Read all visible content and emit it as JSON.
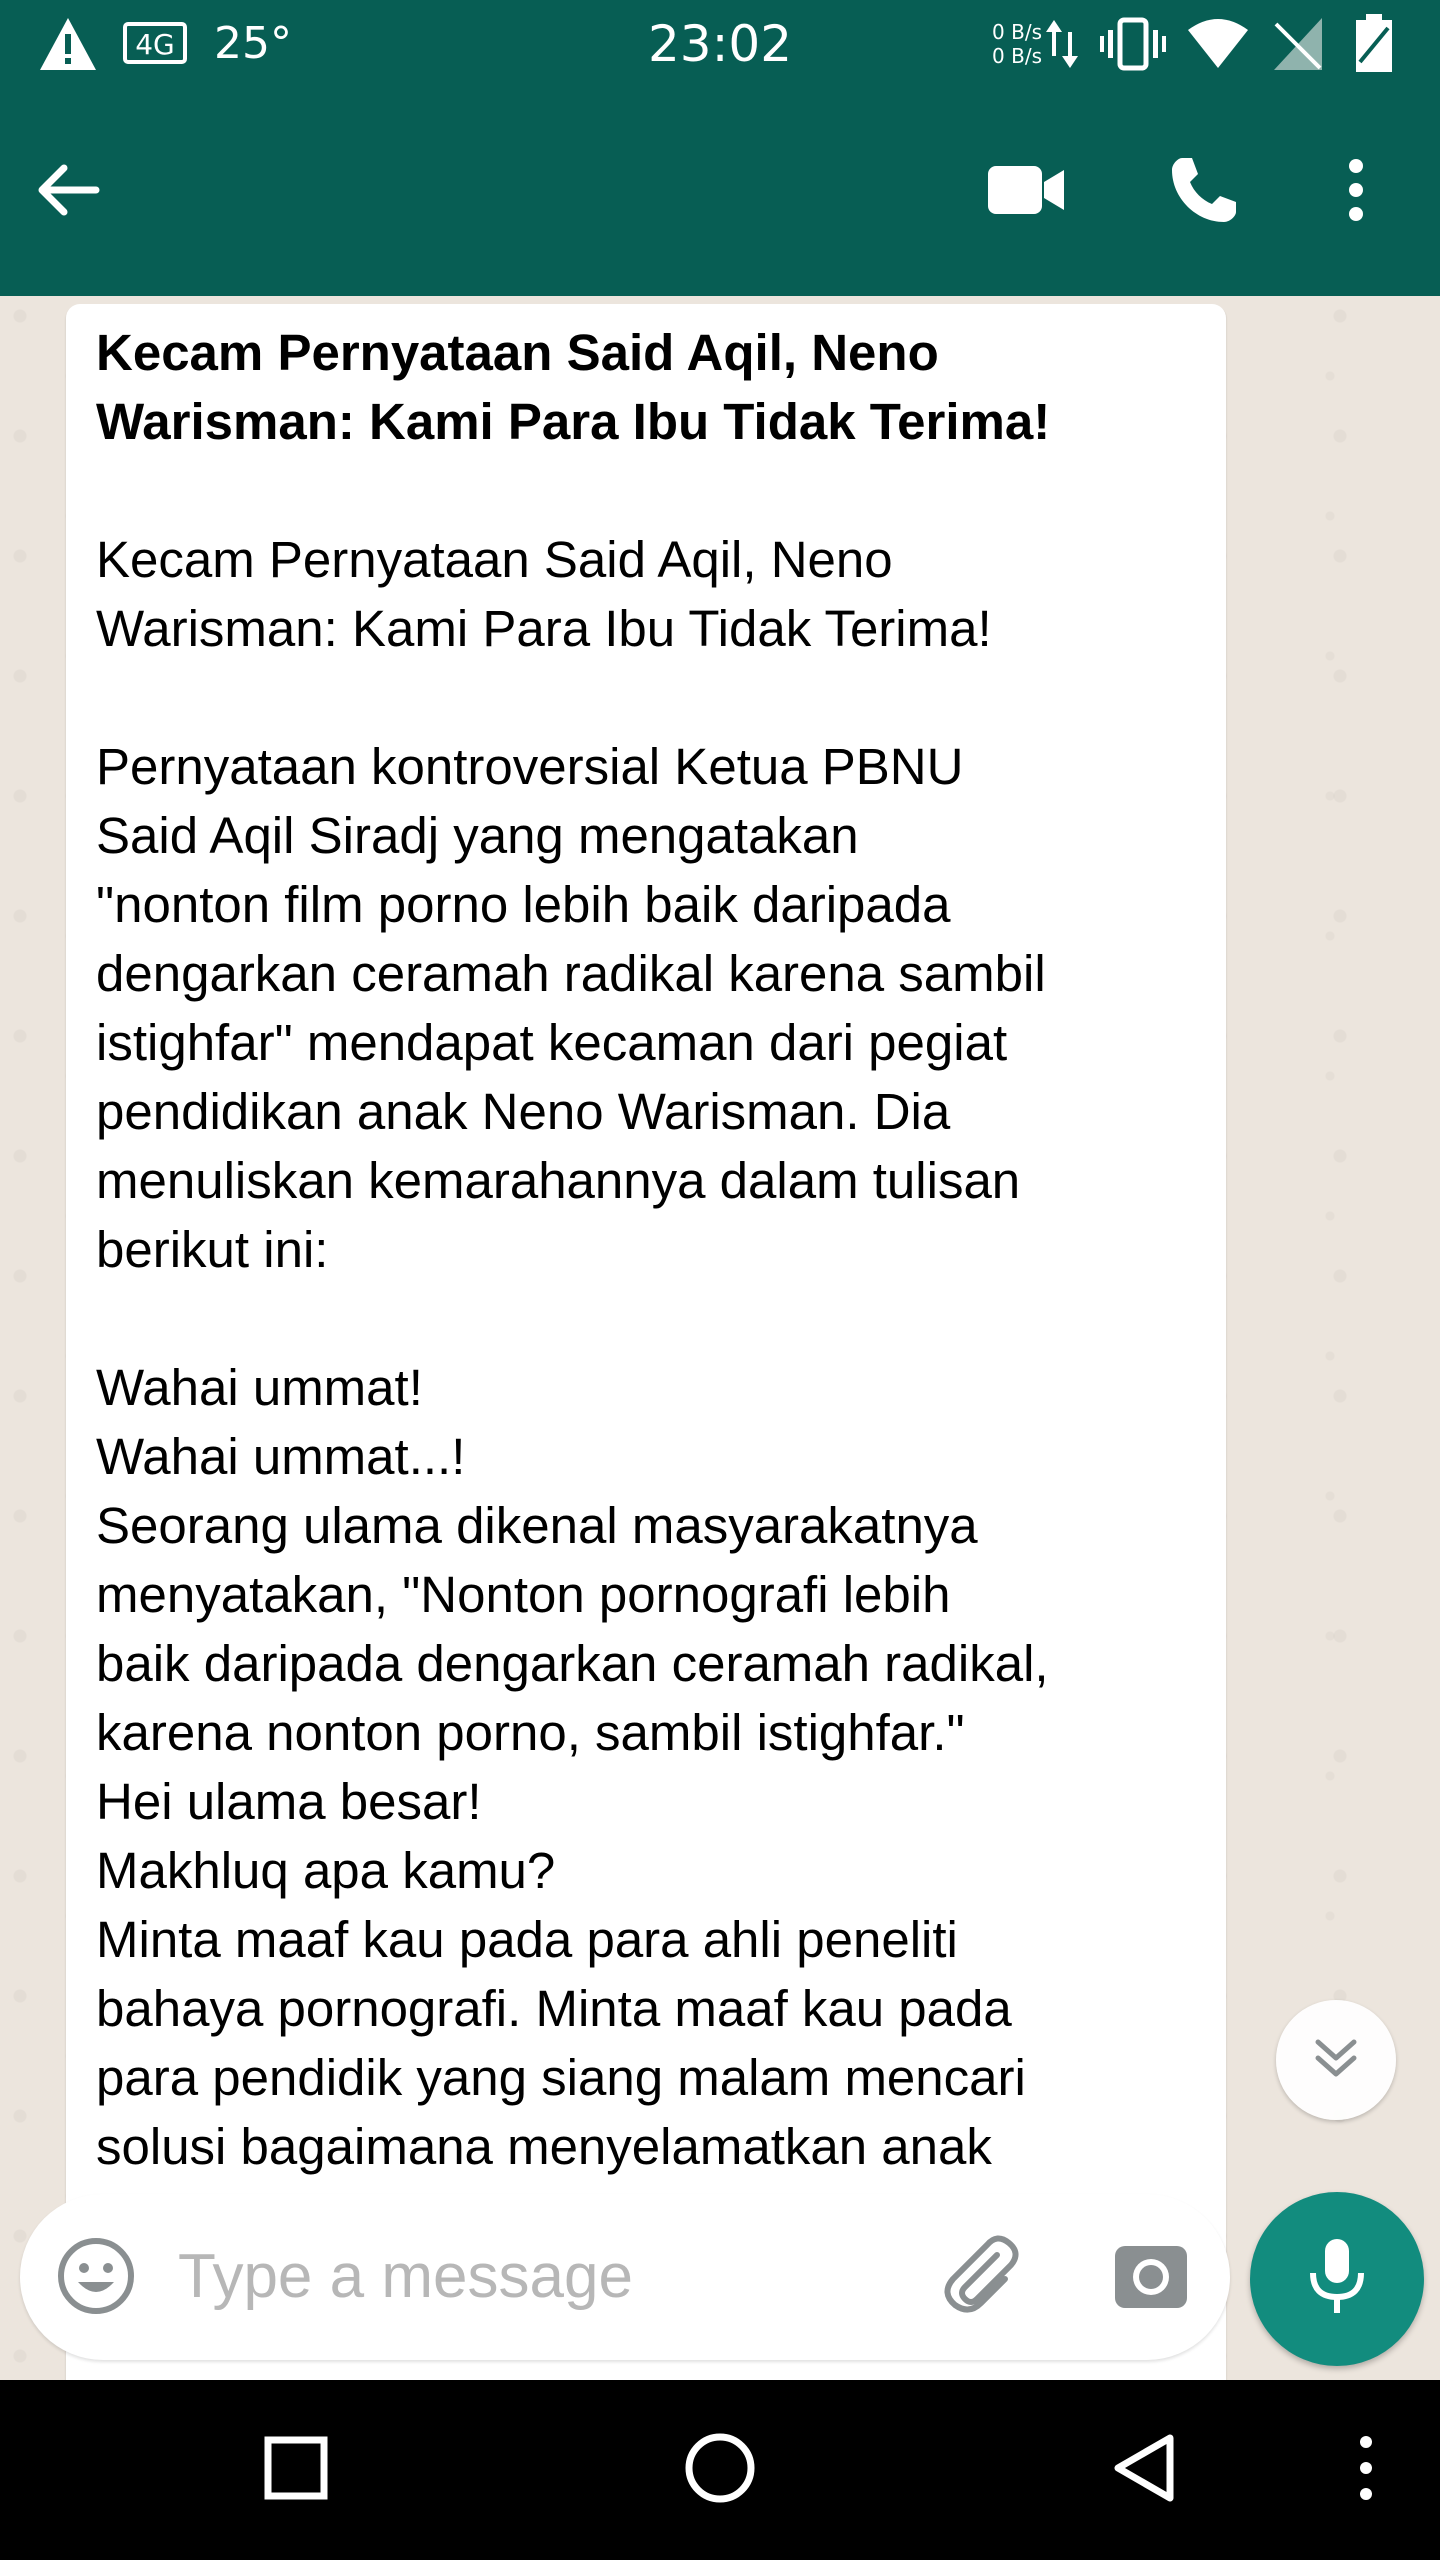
{
  "status_bar": {
    "network_type": "4G",
    "temperature": "25°",
    "time": "23:02",
    "net_up": "0 B/s",
    "net_down": "0 B/s"
  },
  "app_bar": {
    "back_icon": "arrow-back-icon",
    "video_call_icon": "video-camera-icon",
    "voice_call_icon": "phone-icon",
    "menu_icon": "more-vert-icon"
  },
  "message": {
    "title": "Kecam Pernyataan Said Aqil, Neno\nWarisman: Kami Para Ibu Tidak Terima!",
    "body": "\n\nKecam Pernyataan Said Aqil, Neno\nWarisman: Kami Para Ibu Tidak Terima!\n\nPernyataan kontroversial Ketua PBNU\nSaid Aqil Siradj yang mengatakan\n\"nonton film porno lebih baik daripada\ndengarkan ceramah radikal karena sambil\nistighfar\" mendapat kecaman dari pegiat\npendidikan anak Neno Warisman. Dia\nmenuliskan kemarahannya dalam tulisan\nberikut ini:\n\nWahai ummat!\nWahai ummat...!\nSeorang ulama dikenal masyarakatnya\nmenyatakan, \"Nonton pornografi lebih\nbaik daripada dengarkan ceramah radikal,\nkarena nonton porno, sambil istighfar.\"\nHei ulama besar!\nMakhluq apa kamu?\nMinta maaf kau pada para ahli peneliti\nbahaya pornografi. Minta maaf kau pada\npara pendidik yang siang malam mencari\nsolusi bagaimana menyelamatkan anak"
  },
  "composer": {
    "placeholder": "Type a message",
    "emoji_icon": "emoji-icon",
    "attach_icon": "paperclip-icon",
    "camera_icon": "camera-icon",
    "mic_icon": "microphone-icon"
  },
  "colors": {
    "header": "#075e54",
    "chat_bg": "#ece5dd",
    "mic_button": "#128c7e"
  }
}
